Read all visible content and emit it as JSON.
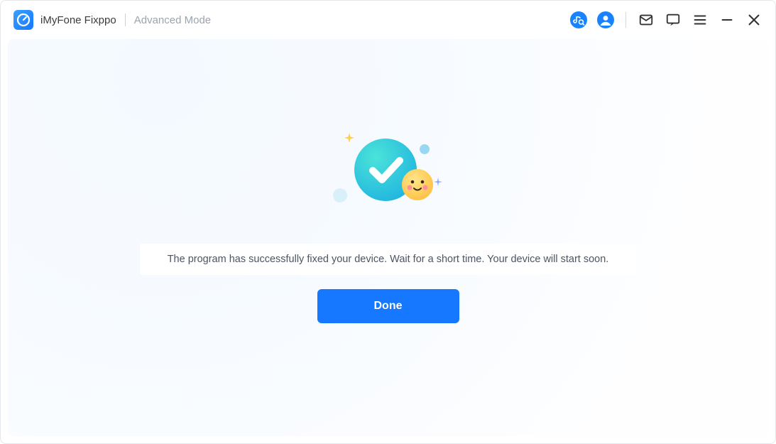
{
  "header": {
    "app_title": "iMyFone Fixppo",
    "mode_label": "Advanced Mode"
  },
  "main": {
    "message": "The program has successfully fixed your device. Wait for a short time. Your device will start soon.",
    "done_label": "Done"
  },
  "icons": {
    "music": "music-search-icon",
    "account": "account-icon",
    "mail": "mail-icon",
    "chat": "chat-icon",
    "menu": "menu-icon",
    "minimize": "minimize-icon",
    "close": "close-icon"
  },
  "colors": {
    "accent": "#1677ff",
    "icon_blue": "#1983ff",
    "check_start": "#2bd8cf",
    "check_end": "#25b6e6",
    "smiley_start": "#ffe07a",
    "smiley_end": "#ffc24a"
  }
}
